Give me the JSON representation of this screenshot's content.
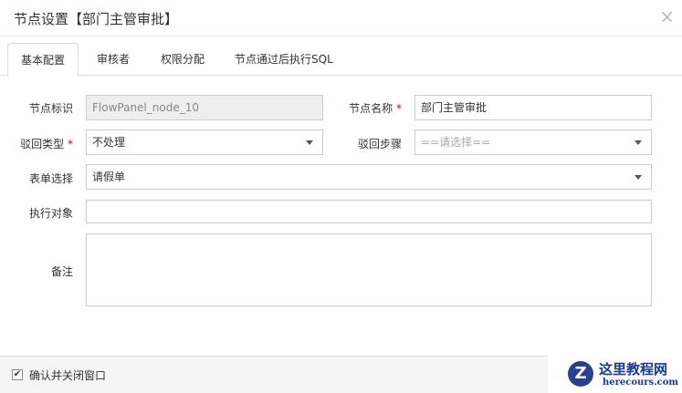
{
  "dialog": {
    "title": "节点设置【部门主管审批】",
    "close": "×"
  },
  "tabs": [
    "基本配置",
    "审核者",
    "权限分配",
    "节点通过后执行SQL"
  ],
  "form": {
    "node_id": {
      "label": "节点标识",
      "value": "FlowPanel_node_10"
    },
    "node_name": {
      "label": "节点名称",
      "value": "部门主管审批",
      "required": "*"
    },
    "reject_type": {
      "label": "驳回类型",
      "value": "不处理",
      "required": "*"
    },
    "reject_step": {
      "label": "驳回步骤",
      "placeholder": "==请选择=="
    },
    "form_select": {
      "label": "表单选择",
      "value": "请假单"
    },
    "exec_target": {
      "label": "执行对象",
      "value": ""
    },
    "remark": {
      "label": "备注",
      "value": ""
    }
  },
  "footer": {
    "checkbox_label": "确认并关闭窗口",
    "checked": true,
    "check_mark": "✔"
  },
  "watermark": {
    "cn": "这里教程网",
    "en": "herecours.com"
  }
}
